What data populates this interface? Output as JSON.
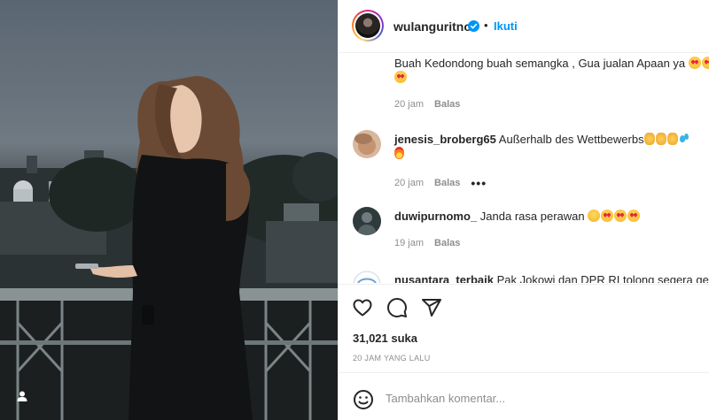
{
  "post": {
    "author": "wulanguritno",
    "follow_label": "Ikuti",
    "dot": "•",
    "likes": "31,021 suka",
    "posted": "20 JAM YANG LALU"
  },
  "comments": [
    {
      "username": "",
      "text": "Buah Kedondong buah semangka , Gua jualan Apaan ya",
      "time": "20 jam",
      "reply": "Balas"
    },
    {
      "username": "jenesis_broberg65",
      "text": "Außerhalb des Wettbewerbs",
      "time": "20 jam",
      "reply": "Balas",
      "more": "•••"
    },
    {
      "username": "duwipurnomo_",
      "text": "Janda rasa perawan",
      "time": "19 jam",
      "reply": "Balas"
    },
    {
      "username": "nusantara_terbaik",
      "text": "Pak Jokowi dan DPR RI tolong segera gelar"
    }
  ],
  "composer": {
    "placeholder": "Tambahkan komentar..."
  },
  "icons": {
    "verified": "verified-badge-icon",
    "like": "heart-icon",
    "comment": "comment-bubble-icon",
    "share": "paper-plane-icon",
    "emoji": "smiley-icon",
    "tag": "user-tag-icon"
  },
  "colors": {
    "accent": "#0095f6",
    "text": "#262626",
    "muted": "#8e8e8e"
  }
}
